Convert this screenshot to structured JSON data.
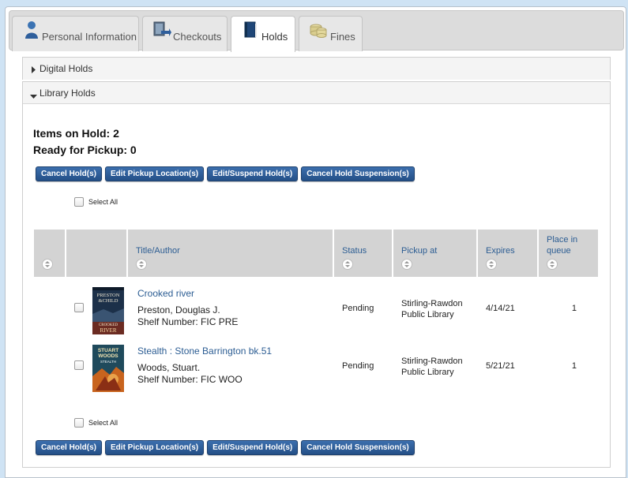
{
  "tabs": [
    {
      "label": "Personal Information",
      "icon": "person-icon",
      "active": false
    },
    {
      "label": "Checkouts",
      "icon": "checkout-icon",
      "active": false
    },
    {
      "label": "Holds",
      "icon": "book-icon",
      "active": true
    },
    {
      "label": "Fines",
      "icon": "coins-icon",
      "active": false
    }
  ],
  "digital_holds": {
    "label": "Digital Holds",
    "expanded": false
  },
  "library_holds": {
    "label": "Library Holds",
    "expanded": true,
    "items_on_hold": "Items on Hold: 2",
    "ready_for_pickup": "Ready for Pickup: 0",
    "buttons": {
      "cancel": "Cancel Hold(s)",
      "edit_pickup": "Edit Pickup Location(s)",
      "edit_suspend": "Edit/Suspend Hold(s)",
      "cancel_suspension": "Cancel Hold Suspension(s)"
    },
    "select_all": "Select All",
    "columns": {
      "title_author": "Title/Author",
      "status": "Status",
      "pickup_at": "Pickup at",
      "expires": "Expires",
      "place_in_queue": "Place in queue"
    },
    "rows": [
      {
        "title": "Crooked river",
        "author": "Preston, Douglas J.",
        "shelf": "Shelf Number: FIC PRE",
        "status": "Pending",
        "pickup_line1": "Stirling-Rawdon",
        "pickup_line2": "Public Library",
        "expires": "4/14/21",
        "queue": "1",
        "cover": {
          "top_text": "PRESTON & CHILD",
          "bottom_text": "CROOKED RIVER",
          "color": "#1c3049",
          "accent": "#c0392b"
        }
      },
      {
        "title": "Stealth : Stone Barrington bk.51",
        "author": "Woods, Stuart.",
        "shelf": "Shelf Number: FIC WOO",
        "status": "Pending",
        "pickup_line1": "Stirling-Rawdon",
        "pickup_line2": "Public Library",
        "expires": "5/21/21",
        "queue": "1",
        "cover": {
          "top_text": "STUART WOODS",
          "bottom_text": "STEALTH",
          "color": "#1f4a5c",
          "accent": "#c8641e"
        }
      }
    ]
  },
  "colors": {
    "link": "#2c5d93",
    "button": "#2f5f9c",
    "header_bg": "#d3d3d3",
    "page_bg": "#cfe3f4"
  }
}
